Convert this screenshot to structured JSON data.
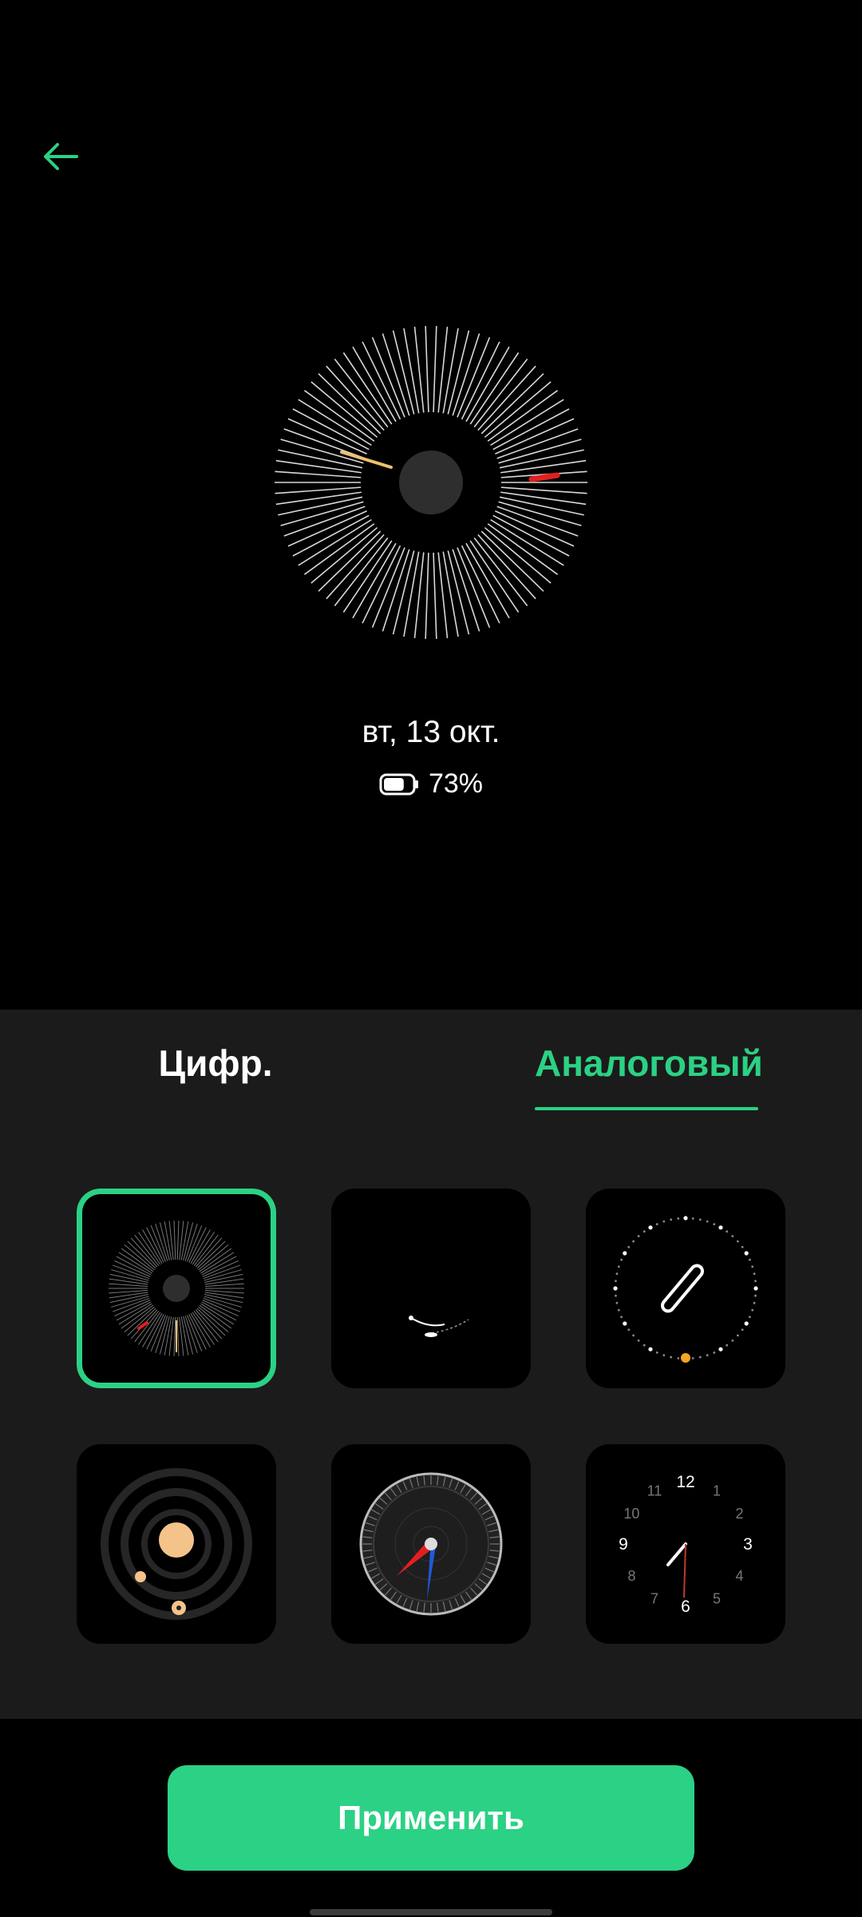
{
  "header": {
    "back_icon": "arrow-left-icon"
  },
  "preview": {
    "date": "вт, 13 окт.",
    "battery_percent": "73%",
    "battery_level": 0.73
  },
  "tabs": [
    {
      "label": "Цифр.",
      "selected": false
    },
    {
      "label": "Аналоговый",
      "selected": true
    }
  ],
  "faces": [
    {
      "name": "radial-lines",
      "selected": true
    },
    {
      "name": "minimal-hands",
      "selected": false
    },
    {
      "name": "dotted-ring",
      "selected": false
    },
    {
      "name": "planet-orbits",
      "selected": false
    },
    {
      "name": "compass",
      "selected": false
    },
    {
      "name": "numbered",
      "selected": false
    }
  ],
  "numbered_face": {
    "numbers": [
      "12",
      "1",
      "2",
      "3",
      "4",
      "5",
      "6",
      "7",
      "8",
      "9",
      "10",
      "11"
    ]
  },
  "apply_button": {
    "label": "Применить"
  },
  "colors": {
    "accent": "#2bd184",
    "sheet": "#1b1b1b",
    "hand_red": "#e02020",
    "hand_gold": "#f0c070"
  }
}
